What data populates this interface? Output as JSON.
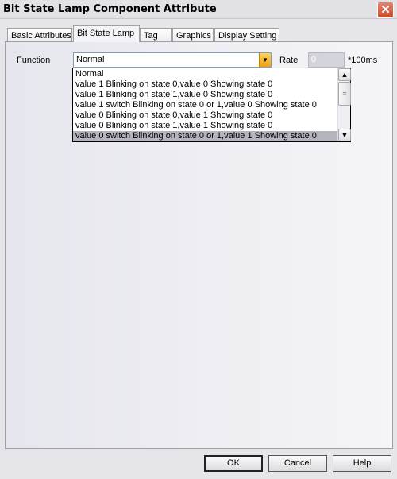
{
  "window": {
    "title": "Bit State Lamp Component Attribute",
    "close_glyph": "✕"
  },
  "tabs": [
    {
      "label": "Basic Attributes"
    },
    {
      "label": "Bit State Lamp",
      "active": true
    },
    {
      "label": "Tag"
    },
    {
      "label": "Graphics"
    },
    {
      "label": "Display Setting"
    }
  ],
  "function": {
    "label": "Function",
    "value": "Normal",
    "options": [
      "Normal",
      "value 1 Blinking on state 0,value 0 Showing state 0",
      "value 1 Blinking on state 1,value 0 Showing state 0",
      "value 1 switch Blinking on state 0 or 1,value 0 Showing state 0",
      "value 0 Blinking on state 0,value 1 Showing state 0",
      "value 0 Blinking on state 1,value 1 Showing state 0",
      "value 0 switch Blinking on state 0 or 1,value 1 Showing state 0"
    ],
    "highlighted_index": 6
  },
  "rate": {
    "label": "Rate",
    "value": "0",
    "unit": "*100ms"
  },
  "buttons": {
    "ok": "OK",
    "cancel": "Cancel",
    "help": "Help"
  },
  "colors": {
    "dropdown_button": "#f0a010",
    "selection": "#b4b4bc"
  }
}
